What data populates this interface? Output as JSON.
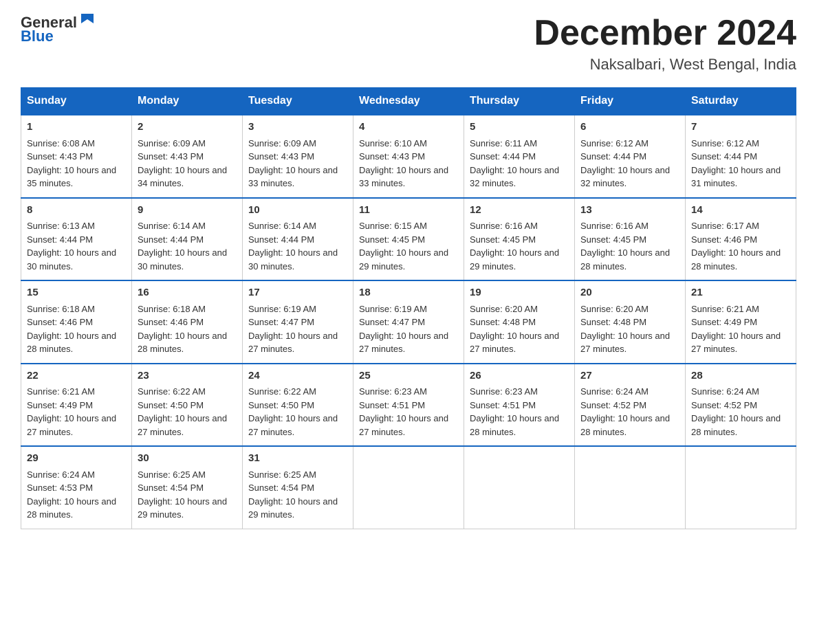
{
  "logo": {
    "text_general": "General",
    "text_blue": "Blue"
  },
  "title": "December 2024",
  "location": "Naksalbari, West Bengal, India",
  "headers": [
    "Sunday",
    "Monday",
    "Tuesday",
    "Wednesday",
    "Thursday",
    "Friday",
    "Saturday"
  ],
  "weeks": [
    [
      {
        "day": "1",
        "sunrise": "6:08 AM",
        "sunset": "4:43 PM",
        "daylight": "10 hours and 35 minutes."
      },
      {
        "day": "2",
        "sunrise": "6:09 AM",
        "sunset": "4:43 PM",
        "daylight": "10 hours and 34 minutes."
      },
      {
        "day": "3",
        "sunrise": "6:09 AM",
        "sunset": "4:43 PM",
        "daylight": "10 hours and 33 minutes."
      },
      {
        "day": "4",
        "sunrise": "6:10 AM",
        "sunset": "4:43 PM",
        "daylight": "10 hours and 33 minutes."
      },
      {
        "day": "5",
        "sunrise": "6:11 AM",
        "sunset": "4:44 PM",
        "daylight": "10 hours and 32 minutes."
      },
      {
        "day": "6",
        "sunrise": "6:12 AM",
        "sunset": "4:44 PM",
        "daylight": "10 hours and 32 minutes."
      },
      {
        "day": "7",
        "sunrise": "6:12 AM",
        "sunset": "4:44 PM",
        "daylight": "10 hours and 31 minutes."
      }
    ],
    [
      {
        "day": "8",
        "sunrise": "6:13 AM",
        "sunset": "4:44 PM",
        "daylight": "10 hours and 30 minutes."
      },
      {
        "day": "9",
        "sunrise": "6:14 AM",
        "sunset": "4:44 PM",
        "daylight": "10 hours and 30 minutes."
      },
      {
        "day": "10",
        "sunrise": "6:14 AM",
        "sunset": "4:44 PM",
        "daylight": "10 hours and 30 minutes."
      },
      {
        "day": "11",
        "sunrise": "6:15 AM",
        "sunset": "4:45 PM",
        "daylight": "10 hours and 29 minutes."
      },
      {
        "day": "12",
        "sunrise": "6:16 AM",
        "sunset": "4:45 PM",
        "daylight": "10 hours and 29 minutes."
      },
      {
        "day": "13",
        "sunrise": "6:16 AM",
        "sunset": "4:45 PM",
        "daylight": "10 hours and 28 minutes."
      },
      {
        "day": "14",
        "sunrise": "6:17 AM",
        "sunset": "4:46 PM",
        "daylight": "10 hours and 28 minutes."
      }
    ],
    [
      {
        "day": "15",
        "sunrise": "6:18 AM",
        "sunset": "4:46 PM",
        "daylight": "10 hours and 28 minutes."
      },
      {
        "day": "16",
        "sunrise": "6:18 AM",
        "sunset": "4:46 PM",
        "daylight": "10 hours and 28 minutes."
      },
      {
        "day": "17",
        "sunrise": "6:19 AM",
        "sunset": "4:47 PM",
        "daylight": "10 hours and 27 minutes."
      },
      {
        "day": "18",
        "sunrise": "6:19 AM",
        "sunset": "4:47 PM",
        "daylight": "10 hours and 27 minutes."
      },
      {
        "day": "19",
        "sunrise": "6:20 AM",
        "sunset": "4:48 PM",
        "daylight": "10 hours and 27 minutes."
      },
      {
        "day": "20",
        "sunrise": "6:20 AM",
        "sunset": "4:48 PM",
        "daylight": "10 hours and 27 minutes."
      },
      {
        "day": "21",
        "sunrise": "6:21 AM",
        "sunset": "4:49 PM",
        "daylight": "10 hours and 27 minutes."
      }
    ],
    [
      {
        "day": "22",
        "sunrise": "6:21 AM",
        "sunset": "4:49 PM",
        "daylight": "10 hours and 27 minutes."
      },
      {
        "day": "23",
        "sunrise": "6:22 AM",
        "sunset": "4:50 PM",
        "daylight": "10 hours and 27 minutes."
      },
      {
        "day": "24",
        "sunrise": "6:22 AM",
        "sunset": "4:50 PM",
        "daylight": "10 hours and 27 minutes."
      },
      {
        "day": "25",
        "sunrise": "6:23 AM",
        "sunset": "4:51 PM",
        "daylight": "10 hours and 27 minutes."
      },
      {
        "day": "26",
        "sunrise": "6:23 AM",
        "sunset": "4:51 PM",
        "daylight": "10 hours and 28 minutes."
      },
      {
        "day": "27",
        "sunrise": "6:24 AM",
        "sunset": "4:52 PM",
        "daylight": "10 hours and 28 minutes."
      },
      {
        "day": "28",
        "sunrise": "6:24 AM",
        "sunset": "4:52 PM",
        "daylight": "10 hours and 28 minutes."
      }
    ],
    [
      {
        "day": "29",
        "sunrise": "6:24 AM",
        "sunset": "4:53 PM",
        "daylight": "10 hours and 28 minutes."
      },
      {
        "day": "30",
        "sunrise": "6:25 AM",
        "sunset": "4:54 PM",
        "daylight": "10 hours and 29 minutes."
      },
      {
        "day": "31",
        "sunrise": "6:25 AM",
        "sunset": "4:54 PM",
        "daylight": "10 hours and 29 minutes."
      },
      null,
      null,
      null,
      null
    ]
  ]
}
